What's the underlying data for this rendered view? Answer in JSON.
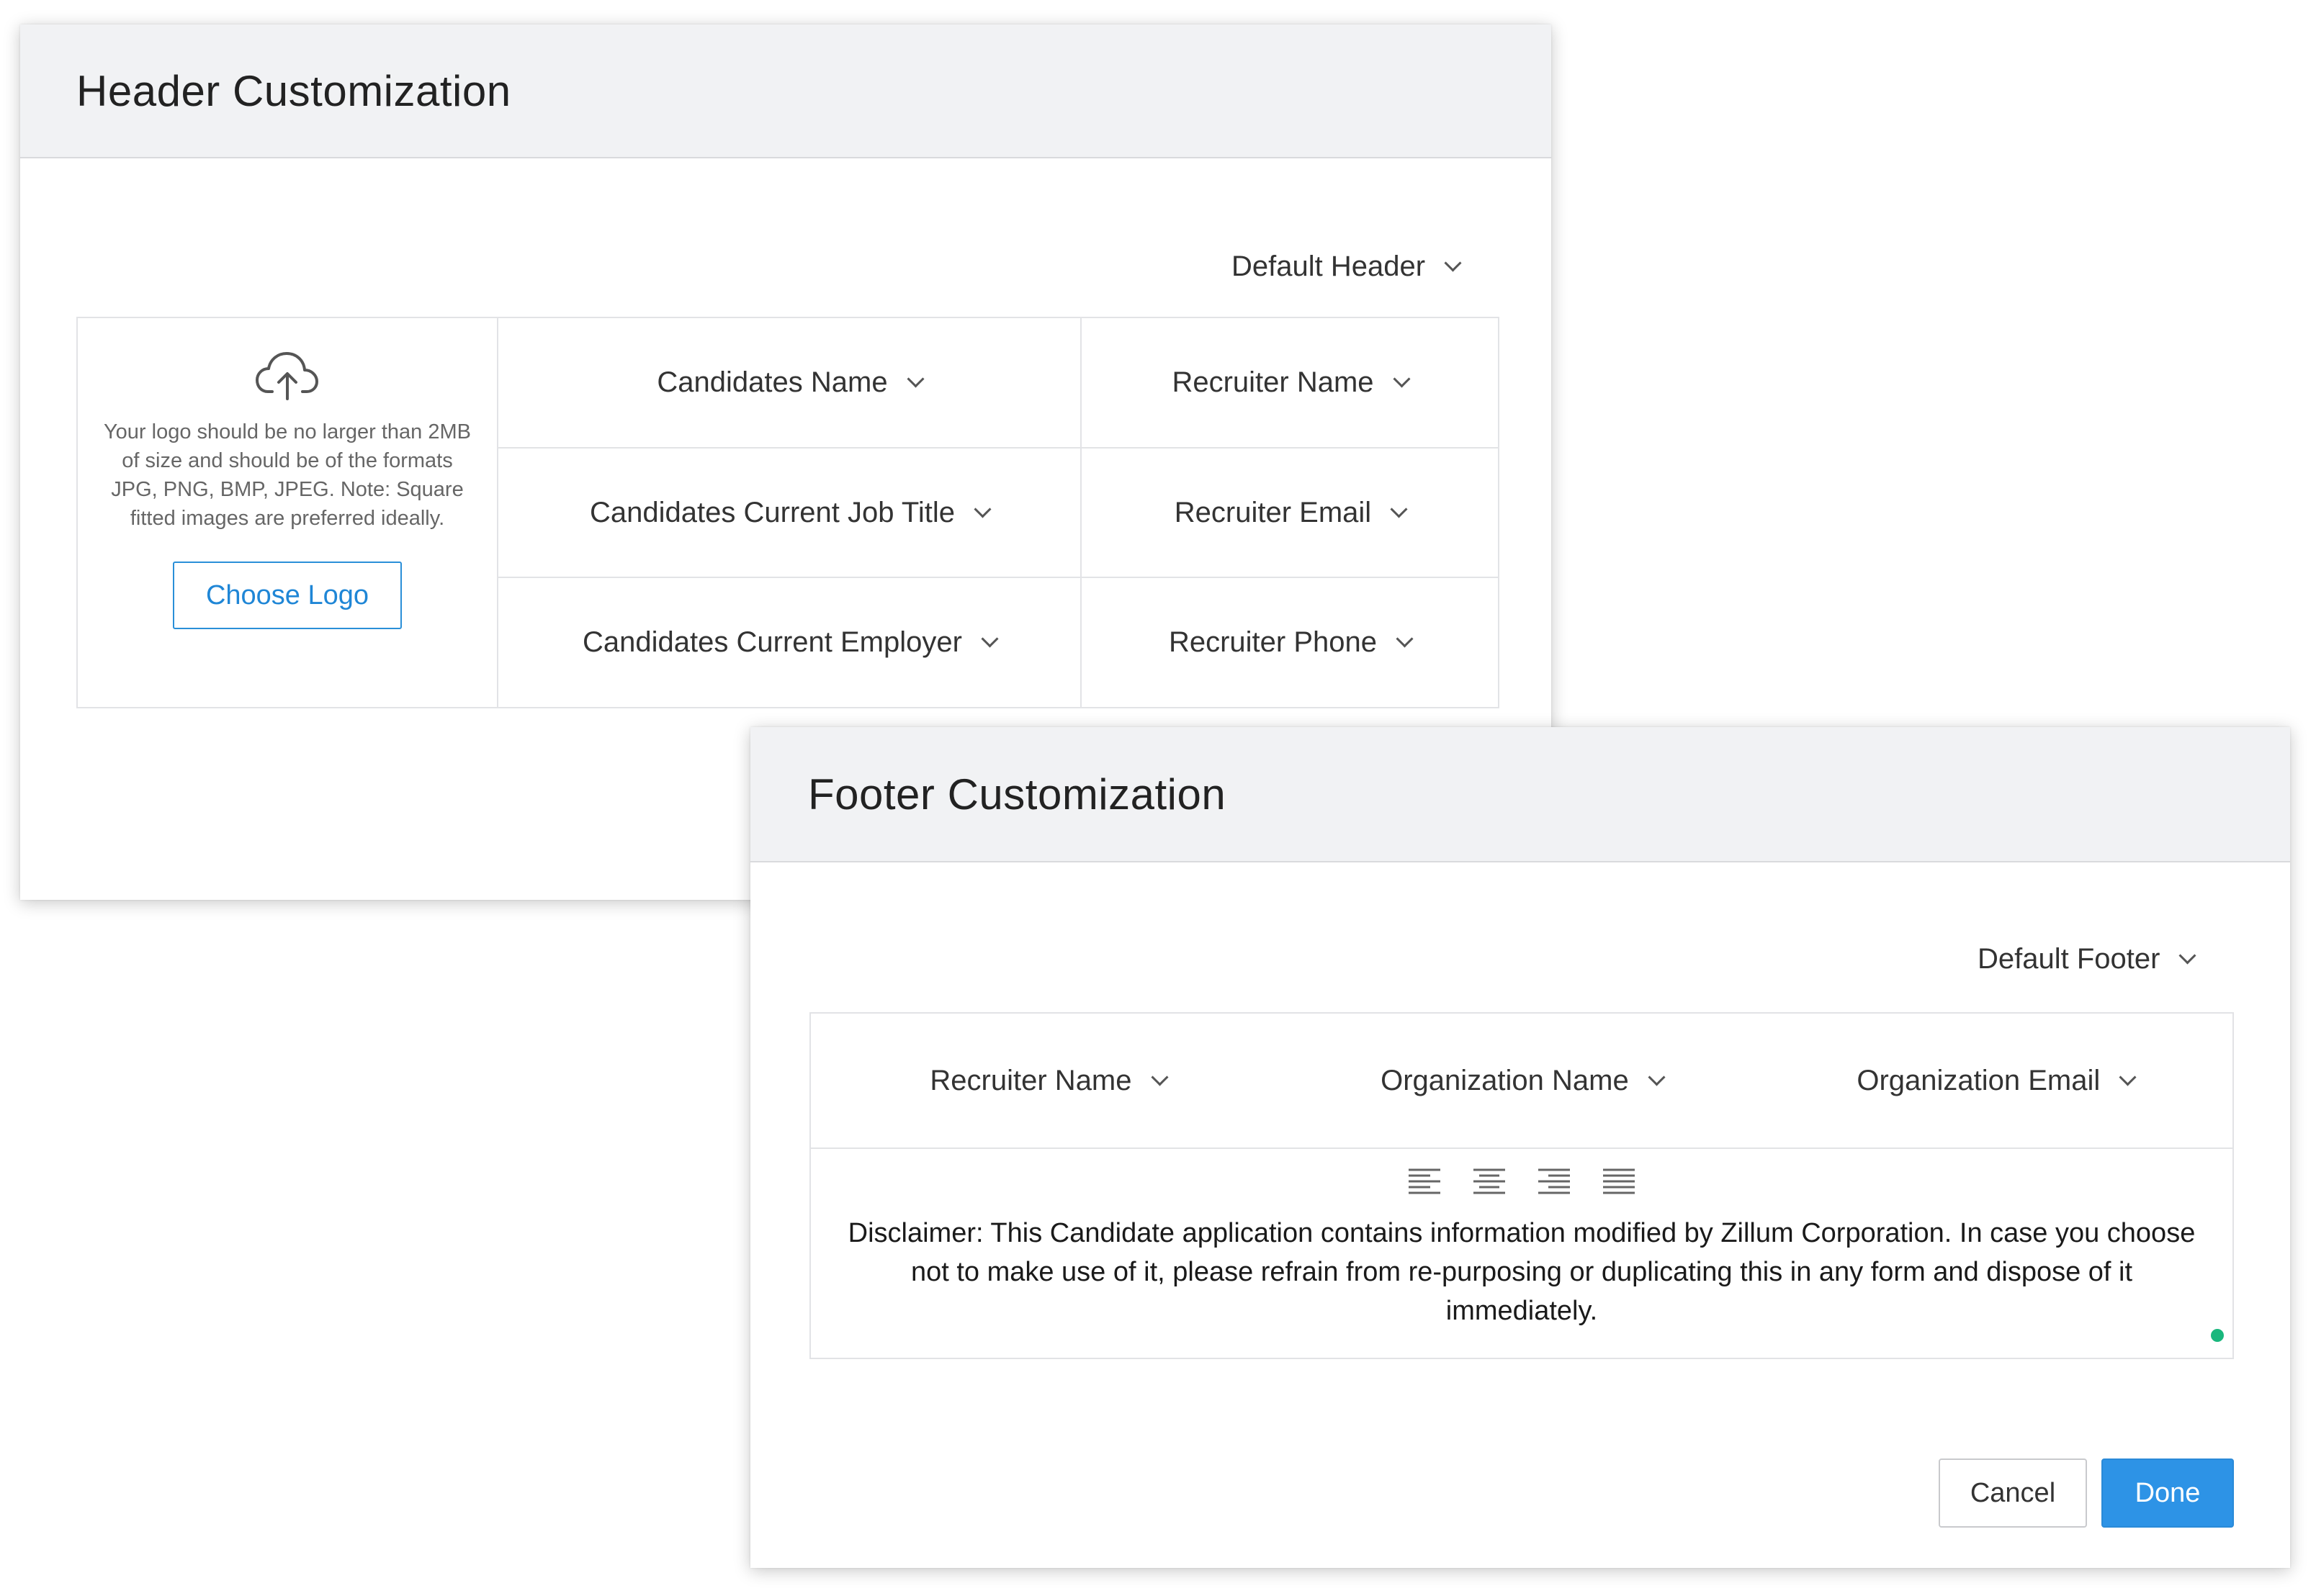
{
  "header_panel": {
    "title": "Header Customization",
    "template_select": "Default Header",
    "logo": {
      "note": "Your logo should be no larger than 2MB of size and should be of the formats JPG, PNG, BMP, JPEG. Note: Square fitted images are preferred ideally.",
      "button_label": "Choose Logo",
      "icon": "cloud-upload-icon"
    },
    "candidate_fields": [
      "Candidates Name",
      "Candidates Current Job Title",
      "Candidates Current Employer"
    ],
    "recruiter_fields": [
      "Recruiter Name",
      "Recruiter Email",
      "Recruiter Phone"
    ]
  },
  "footer_panel": {
    "title": "Footer Customization",
    "template_select": "Default Footer",
    "fields": [
      "Recruiter Name",
      "Organization Name",
      "Organization Email"
    ],
    "alignment_tools": [
      "align-left-icon",
      "align-center-icon",
      "align-right-icon",
      "align-justify-icon"
    ],
    "disclaimer": "Disclaimer: This Candidate application contains information modified by Zillum Corporation. In case you choose not to make use of it, please refrain from re-purposing or duplicating this in any form and dispose of it immediately.",
    "cancel_label": "Cancel",
    "done_label": "Done"
  },
  "colors": {
    "accent": "#2d93e6",
    "header_bg": "#f1f2f4",
    "border": "#e2e3e6",
    "status_dot": "#19b77d"
  }
}
